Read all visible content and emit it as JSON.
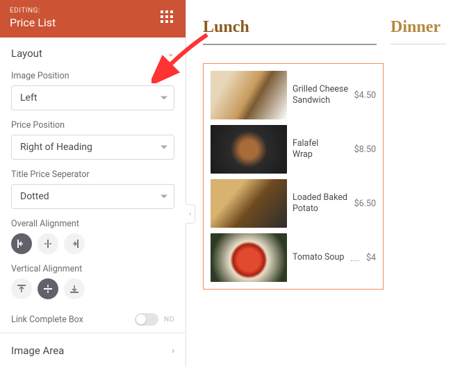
{
  "panel": {
    "kicker": "EDITING:",
    "title": "Price List",
    "sections": {
      "layout": "Layout",
      "image_area": "Image Area"
    },
    "fields": {
      "image_position": {
        "label": "Image Position",
        "value": "Left"
      },
      "price_position": {
        "label": "Price Position",
        "value": "Right of Heading"
      },
      "separator": {
        "label": "Title Price Seperator",
        "value": "Dotted"
      },
      "overall_alignment": {
        "label": "Overall Alignment"
      },
      "vertical_alignment": {
        "label": "Vertical Alignment"
      },
      "link_box": {
        "label": "Link Complete Box",
        "state": "NO"
      }
    }
  },
  "canvas": {
    "tabs": {
      "lunch": "Lunch",
      "dinner": "Dinner"
    },
    "items": [
      {
        "name": "Grilled Cheese Sandwich",
        "price": "$4.50"
      },
      {
        "name": "Falafel Wrap",
        "price": "$8.50"
      },
      {
        "name": "Loaded Baked Potato",
        "price": "$6.50"
      },
      {
        "name": "Tomato Soup",
        "price": "$4"
      }
    ]
  }
}
